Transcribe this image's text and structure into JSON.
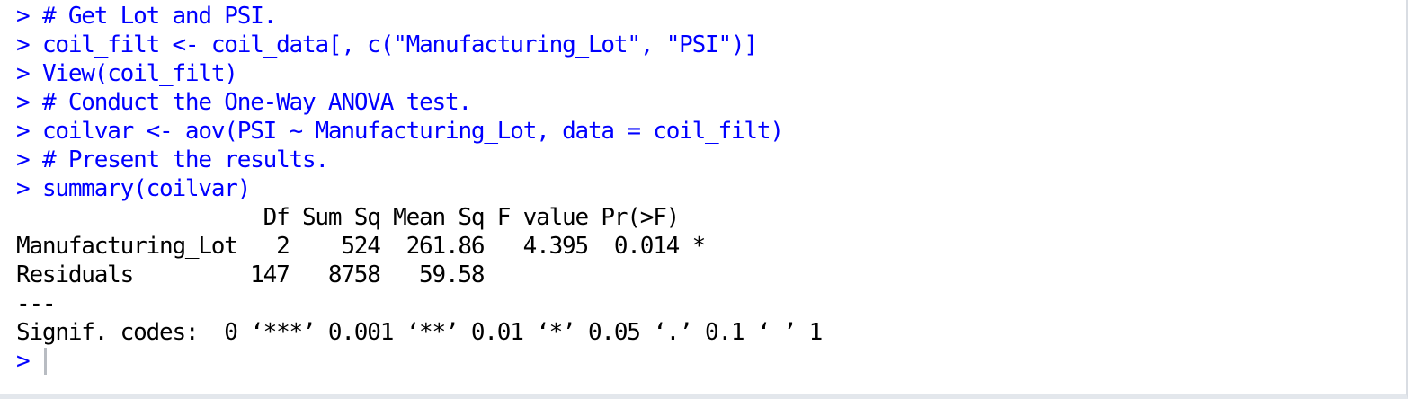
{
  "console": {
    "commands": [
      {
        "prompt": ">",
        "text": "# Get Lot and PSI."
      },
      {
        "prompt": ">",
        "text": "coil_filt <- coil_data[, c(\"Manufacturing_Lot\", \"PSI\")]"
      },
      {
        "prompt": ">",
        "text": "View(coil_filt)"
      },
      {
        "prompt": ">",
        "text": "# Conduct the One-Way ANOVA test."
      },
      {
        "prompt": ">",
        "text": "coilvar <- aov(PSI ~ Manufacturing_Lot, data = coil_filt)"
      },
      {
        "prompt": ">",
        "text": "# Present the results."
      },
      {
        "prompt": ">",
        "text": "summary(coilvar)"
      }
    ],
    "output": {
      "header": "                   Df Sum Sq Mean Sq F value Pr(>F)",
      "rows": [
        "Manufacturing_Lot   2    524  261.86   4.395  0.014 *",
        "Residuals         147   8758   59.58"
      ],
      "separator": "---",
      "signif_codes": "Signif. codes:  0 ‘***’ 0.001 ‘**’ 0.01 ‘*’ 0.05 ‘.’ 0.1 ‘ ’ 1"
    },
    "input_prompt": ">"
  },
  "colors": {
    "command": "#0000ff",
    "output": "#000000",
    "background": "#ffffff"
  }
}
